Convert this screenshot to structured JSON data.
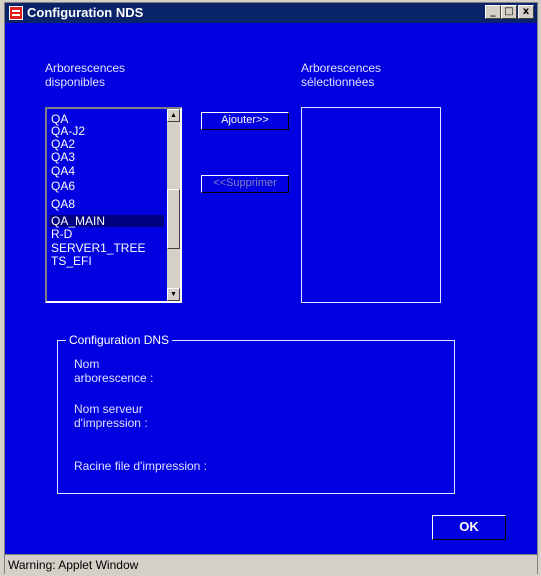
{
  "window": {
    "title": "Configuration NDS",
    "min_glyph": "_",
    "max_glyph": "□",
    "close_glyph": "x"
  },
  "available": {
    "label_line1": "Arborescences",
    "label_line2": "disponibles",
    "items": [
      "QA",
      "QA-J2",
      "QA2",
      "QA3",
      "QA4",
      "QA6",
      "QA8",
      "QA_MAIN",
      "R-D",
      "SERVER1_TREE",
      "TS_EFI"
    ],
    "selected_index": 7,
    "scroll_up": "▲",
    "scroll_down": "▼"
  },
  "selected": {
    "label_line1": "Arborescences",
    "label_line2": "sélectionnées"
  },
  "buttons": {
    "add": "Ajouter>>",
    "remove": "<<Supprimer",
    "ok": "OK"
  },
  "dns": {
    "title": "Configuration DNS",
    "tree_name_line1": "Nom",
    "tree_name_line2": "arborescence :",
    "print_server_line1": "Nom serveur",
    "print_server_line2": "d'impression :",
    "print_queue_root": "Racine file d'impression :"
  },
  "status": {
    "text": "Warning: Applet Window"
  },
  "colors": {
    "background": "#0000e0",
    "titlebar": "#0a246a",
    "selection": "#000080"
  }
}
